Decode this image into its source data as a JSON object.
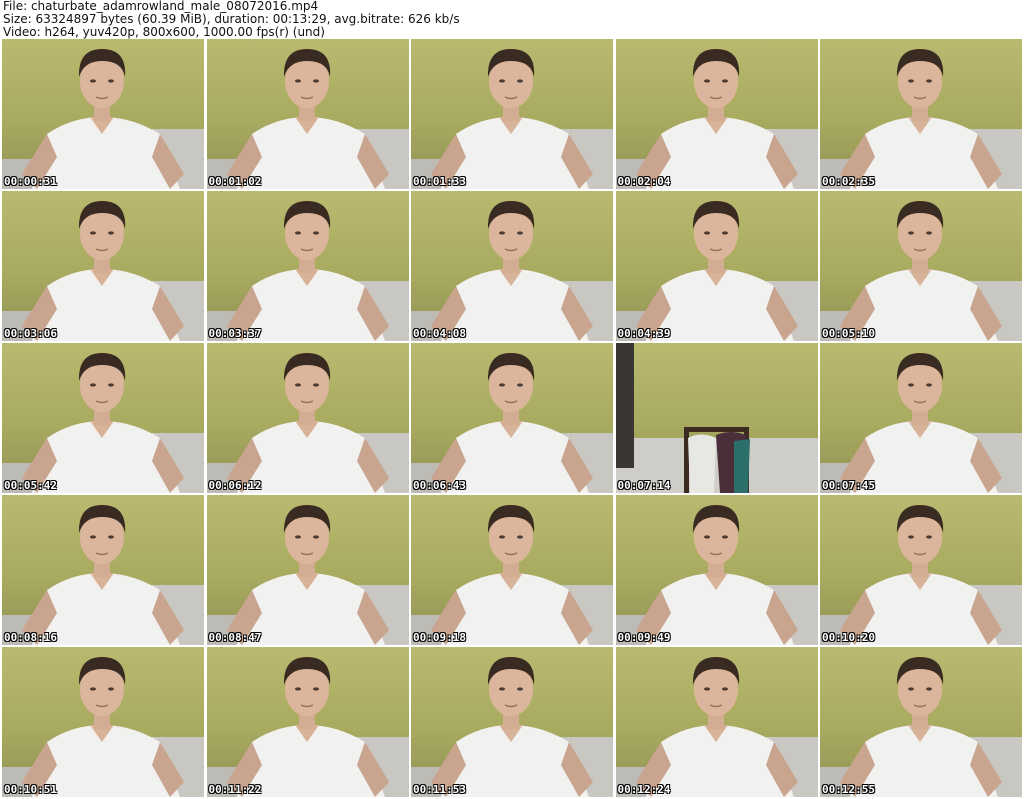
{
  "header": {
    "line1": "File: chaturbate_adamrowland_male_08072016.mp4",
    "line2": "Size: 63324897 bytes (60.39 MiB), duration: 00:13:29, avg.bitrate: 626 kb/s",
    "line3": "Video: h264, yuv420p, 800x600, 1000.00 fps(r) (und)"
  },
  "frames": [
    {
      "time": "00:00:31",
      "scene": "person"
    },
    {
      "time": "00:01:02",
      "scene": "person"
    },
    {
      "time": "00:01:33",
      "scene": "person"
    },
    {
      "time": "00:02:04",
      "scene": "person"
    },
    {
      "time": "00:02:35",
      "scene": "person"
    },
    {
      "time": "00:03:06",
      "scene": "person"
    },
    {
      "time": "00:03:37",
      "scene": "person"
    },
    {
      "time": "00:04:08",
      "scene": "person"
    },
    {
      "time": "00:04:39",
      "scene": "person"
    },
    {
      "time": "00:05:10",
      "scene": "person"
    },
    {
      "time": "00:05:42",
      "scene": "person"
    },
    {
      "time": "00:06:12",
      "scene": "person"
    },
    {
      "time": "00:06:43",
      "scene": "person"
    },
    {
      "time": "00:07:14",
      "scene": "empty-room"
    },
    {
      "time": "00:07:45",
      "scene": "person"
    },
    {
      "time": "00:08:16",
      "scene": "person"
    },
    {
      "time": "00:08:47",
      "scene": "person"
    },
    {
      "time": "00:09:18",
      "scene": "person"
    },
    {
      "time": "00:09:49",
      "scene": "person"
    },
    {
      "time": "00:10:20",
      "scene": "person"
    },
    {
      "time": "00:10:51",
      "scene": "person"
    },
    {
      "time": "00:11:22",
      "scene": "person"
    },
    {
      "time": "00:11:53",
      "scene": "person"
    },
    {
      "time": "00:12:24",
      "scene": "person"
    },
    {
      "time": "00:12:55",
      "scene": "person"
    }
  ]
}
